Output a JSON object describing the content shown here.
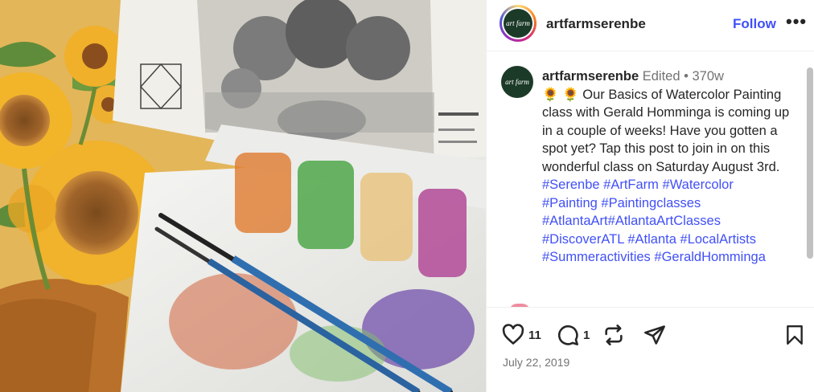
{
  "post": {
    "username": "artfarmserenbe",
    "follow_label": "Follow",
    "more_label": "•••",
    "avatar_text": "art farm",
    "caption": {
      "username": "artfarmserenbe",
      "edited": "Edited",
      "dot": "•",
      "age": "370w",
      "emoji": "🌻 🌻",
      "text": "Our Basics of Watercolor Painting class with Gerald Homminga is coming up in a couple of weeks! Have you gotten a spot yet? Tap this post to join in on this wonderful class on Saturday August 3rd.",
      "hashtags": [
        "#Serenbe",
        "#ArtFarm",
        "#Watercolor",
        "#Painting",
        "#Paintingclasses",
        "#AtlantaArt",
        "#AtlantaArtClasses",
        "#DiscoverATL",
        "#Atlanta",
        "#LocalArtists",
        "#Summeractivities",
        "#GeraldHomminga"
      ]
    },
    "likes": "11",
    "comments": "1",
    "date": "July 22, 2019"
  },
  "icons": [
    "heart-icon",
    "comment-icon",
    "repost-icon",
    "share-icon",
    "bookmark-icon",
    "more-icon"
  ],
  "colors": {
    "link": "#4150f7",
    "text": "#262626",
    "muted": "#737373",
    "avatar_bg": "#1c3a28"
  }
}
